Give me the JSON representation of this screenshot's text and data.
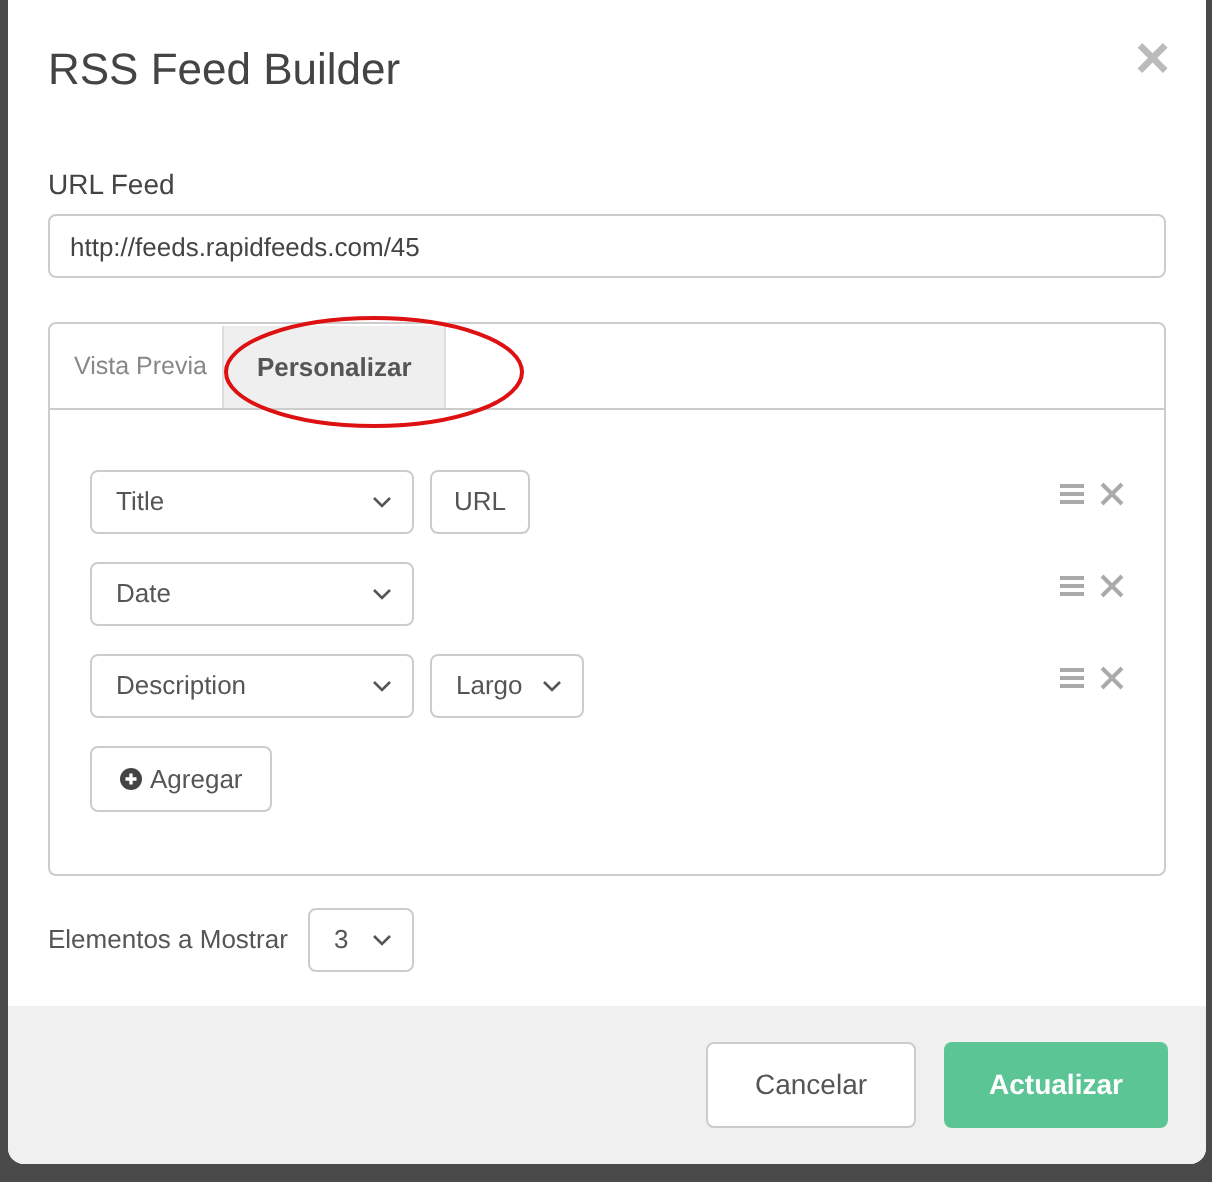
{
  "dialog": {
    "title": "RSS Feed Builder",
    "close": "×"
  },
  "url_feed": {
    "label": "URL Feed",
    "value": "http://feeds.rapidfeeds.com/45"
  },
  "tabs": [
    {
      "label": "Vista Previa",
      "selected": false
    },
    {
      "label": "Personalizar",
      "selected": true,
      "annotated": true
    }
  ],
  "fields": [
    {
      "field": "Title",
      "extra": {
        "kind": "button",
        "label": "URL"
      }
    },
    {
      "field": "Date"
    },
    {
      "field": "Description",
      "extra": {
        "kind": "select",
        "label": "Largo"
      }
    }
  ],
  "add_button": "Agregar",
  "items_to_show": {
    "label": "Elementos a Mostrar",
    "value": "3"
  },
  "buttons": [
    {
      "label": "Cancelar",
      "kind": "secondary"
    },
    {
      "label": "Actualizar",
      "kind": "primary"
    }
  ]
}
